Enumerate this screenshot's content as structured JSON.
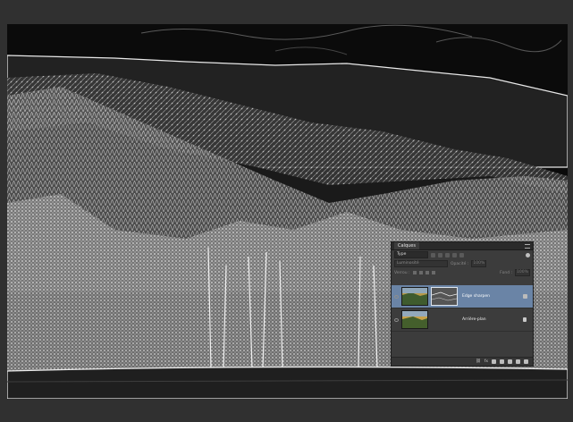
{
  "layers_panel": {
    "tab_label": "Calques",
    "filter_kind": "Type",
    "blend_mode": "Luminosité",
    "opacity_label": "Opacité :",
    "opacity_value": "100%",
    "lock_label": "Verrou :",
    "fill_label": "Fond :",
    "fill_value": "100%",
    "layers": [
      {
        "name": "Edge sharpen",
        "selected": true
      },
      {
        "name": "Arrière-plan",
        "selected": false
      }
    ],
    "footer_label": "fx"
  },
  "icons": {
    "panel_menu": "hamburger-menu-icon",
    "visibility": "eye-icon",
    "lock": "lock-icon",
    "smart_object": "smart-object-icon"
  },
  "colors": {
    "selected_layer": "#6a84a6",
    "panel_bg": "#3c3c3c",
    "workspace_bg": "#303030"
  }
}
